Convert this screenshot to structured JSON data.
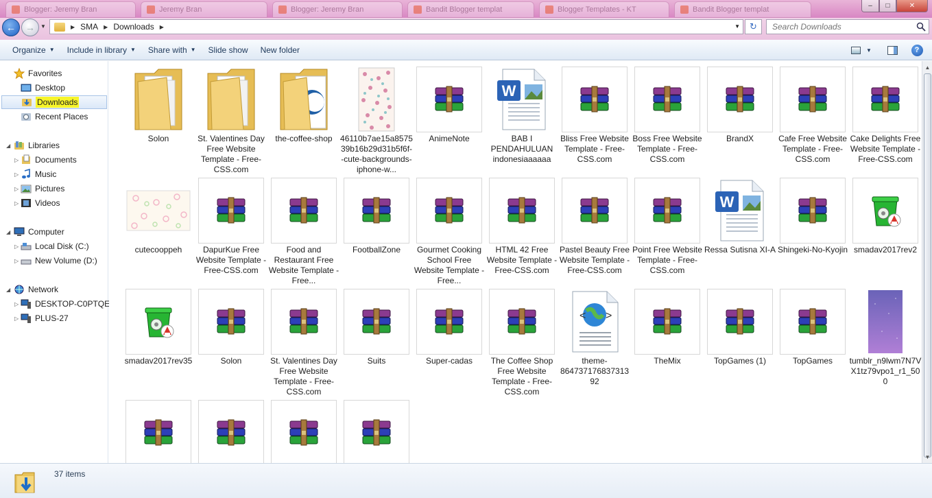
{
  "browser_tabs": [
    {
      "label": "Blogger: Jeremy Bran"
    },
    {
      "label": "Jeremy Bran"
    },
    {
      "label": "Blogger: Jeremy Bran"
    },
    {
      "label": "Bandit Blogger templat"
    },
    {
      "label": "Blogger Templates - KT"
    },
    {
      "label": "Bandit Blogger templat"
    }
  ],
  "window_controls": {
    "minimize": "–",
    "maximize": "□",
    "close": "✕"
  },
  "address": {
    "crumbs": [
      "SMA",
      "Downloads"
    ],
    "search_placeholder": "Search Downloads"
  },
  "toolbar": {
    "organize": "Organize",
    "include_in_library": "Include in library",
    "share_with": "Share with",
    "slide_show": "Slide show",
    "new_folder": "New folder"
  },
  "nav": {
    "favorites": "Favorites",
    "desktop": "Desktop",
    "downloads": "Downloads",
    "recent_places": "Recent Places",
    "libraries": "Libraries",
    "documents": "Documents",
    "music": "Music",
    "pictures": "Pictures",
    "videos": "Videos",
    "computer": "Computer",
    "local_disk": "Local Disk (C:)",
    "new_volume": "New Volume (D:)",
    "network": "Network",
    "desktop_pc": "DESKTOP-C0PTQE9",
    "plus27": "PLUS-27"
  },
  "files": [
    {
      "name": "Solon",
      "icon": "folder-icon"
    },
    {
      "name": "St. Valentines Day Free Website Template - Free-CSS.com",
      "icon": "folder-icon"
    },
    {
      "name": "the-coffee-shop",
      "icon": "folder-icon"
    },
    {
      "name": "46110b7ae15a857539b16b29d31b5f6f--cute-backgrounds-iphone-w...",
      "icon": "image-thumbnail-icon"
    },
    {
      "name": "AnimeNote",
      "icon": "winrar-archive-icon"
    },
    {
      "name": "BAB I PENDAHULUAN indonesiaaaaaa",
      "icon": "word-document-icon"
    },
    {
      "name": "Bliss Free Website Template - Free-CSS.com",
      "icon": "winrar-archive-icon"
    },
    {
      "name": "Boss Free Website Template - Free-CSS.com",
      "icon": "winrar-archive-icon"
    },
    {
      "name": "BrandX",
      "icon": "winrar-archive-icon"
    },
    {
      "name": "Cafe Free Website Template - Free-CSS.com",
      "icon": "winrar-archive-icon"
    },
    {
      "name": "Cake Delights Free Website Template - Free-CSS.com",
      "icon": "winrar-archive-icon"
    },
    {
      "name": "cutecooppeh",
      "icon": "image-thumbnail-icon"
    },
    {
      "name": "DapurKue Free Website Template - Free-CSS.com",
      "icon": "winrar-archive-icon"
    },
    {
      "name": "Food and Restaurant Free Website Template - Free...",
      "icon": "winrar-archive-icon"
    },
    {
      "name": "FootballZone",
      "icon": "winrar-archive-icon"
    },
    {
      "name": "Gourmet Cooking School Free Website Template - Free...",
      "icon": "winrar-archive-icon"
    },
    {
      "name": "HTML 42 Free Website Template - Free-CSS.com",
      "icon": "winrar-archive-icon"
    },
    {
      "name": "Pastel Beauty Free Website Template - Free-CSS.com",
      "icon": "winrar-archive-icon"
    },
    {
      "name": "Point Free Website Template - Free-CSS.com",
      "icon": "winrar-archive-icon"
    },
    {
      "name": "Ressa Sutisna XI-A",
      "icon": "word-document-icon"
    },
    {
      "name": "Shingeki-No-Kyojin",
      "icon": "winrar-archive-icon"
    },
    {
      "name": "smadav2017rev2",
      "icon": "smadav-installer-icon"
    },
    {
      "name": "smadav2017rev35",
      "icon": "smadav-installer-icon"
    },
    {
      "name": "Solon",
      "icon": "winrar-archive-icon"
    },
    {
      "name": "St. Valentines Day Free Website Template - Free-CSS.com",
      "icon": "winrar-archive-icon"
    },
    {
      "name": "Suits",
      "icon": "winrar-archive-icon"
    },
    {
      "name": "Super-cadas",
      "icon": "winrar-archive-icon"
    },
    {
      "name": "The Coffee Shop Free Website Template - Free-CSS.com",
      "icon": "winrar-archive-icon"
    },
    {
      "name": "theme-86473717683731392",
      "icon": "html-document-icon"
    },
    {
      "name": "TheMix",
      "icon": "winrar-archive-icon"
    },
    {
      "name": "TopGames (1)",
      "icon": "winrar-archive-icon"
    },
    {
      "name": "TopGames",
      "icon": "winrar-archive-icon"
    },
    {
      "name": "tumblr_n9lwm7N7VX1tz79vpo1_r1_500",
      "icon": "image-thumbnail-icon"
    },
    {
      "name": "",
      "icon": "winrar-archive-icon"
    },
    {
      "name": "",
      "icon": "winrar-archive-icon"
    },
    {
      "name": "",
      "icon": "winrar-archive-icon"
    },
    {
      "name": "",
      "icon": "winrar-archive-icon"
    }
  ],
  "status": {
    "item_count": "37 items"
  },
  "colors": {
    "selection_highlight": "#f7f52a",
    "title_tint": "#d886c3",
    "command_text": "#1e395b"
  }
}
